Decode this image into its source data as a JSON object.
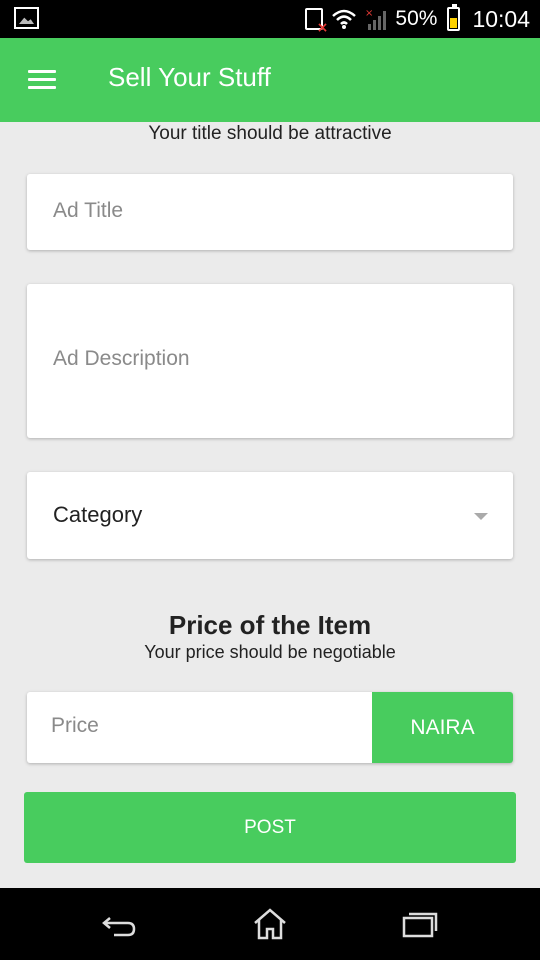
{
  "status_bar": {
    "battery": "50%",
    "time": "10:04"
  },
  "app_bar": {
    "title": "Sell Your Stuff"
  },
  "form": {
    "title_hint": "Your title should be attractive",
    "ad_title_placeholder": "Ad Title",
    "ad_description_placeholder": "Ad Description",
    "category_label": "Category",
    "price_heading": "Price of the Item",
    "price_hint": "Your price should be negotiable",
    "price_placeholder": "Price",
    "currency_label": "NAIRA",
    "post_label": "POST"
  },
  "colors": {
    "accent": "#48cc5e",
    "background": "#ebebeb"
  },
  "icons": {
    "status_left": "gallery-icon",
    "status_right": [
      "sim-card-icon",
      "wifi-icon",
      "signal-icon",
      "battery-icon"
    ],
    "menu": "menu-icon",
    "dropdown": "dropdown-arrow-icon",
    "nav": [
      "back-icon",
      "home-icon",
      "recent-apps-icon"
    ]
  }
}
